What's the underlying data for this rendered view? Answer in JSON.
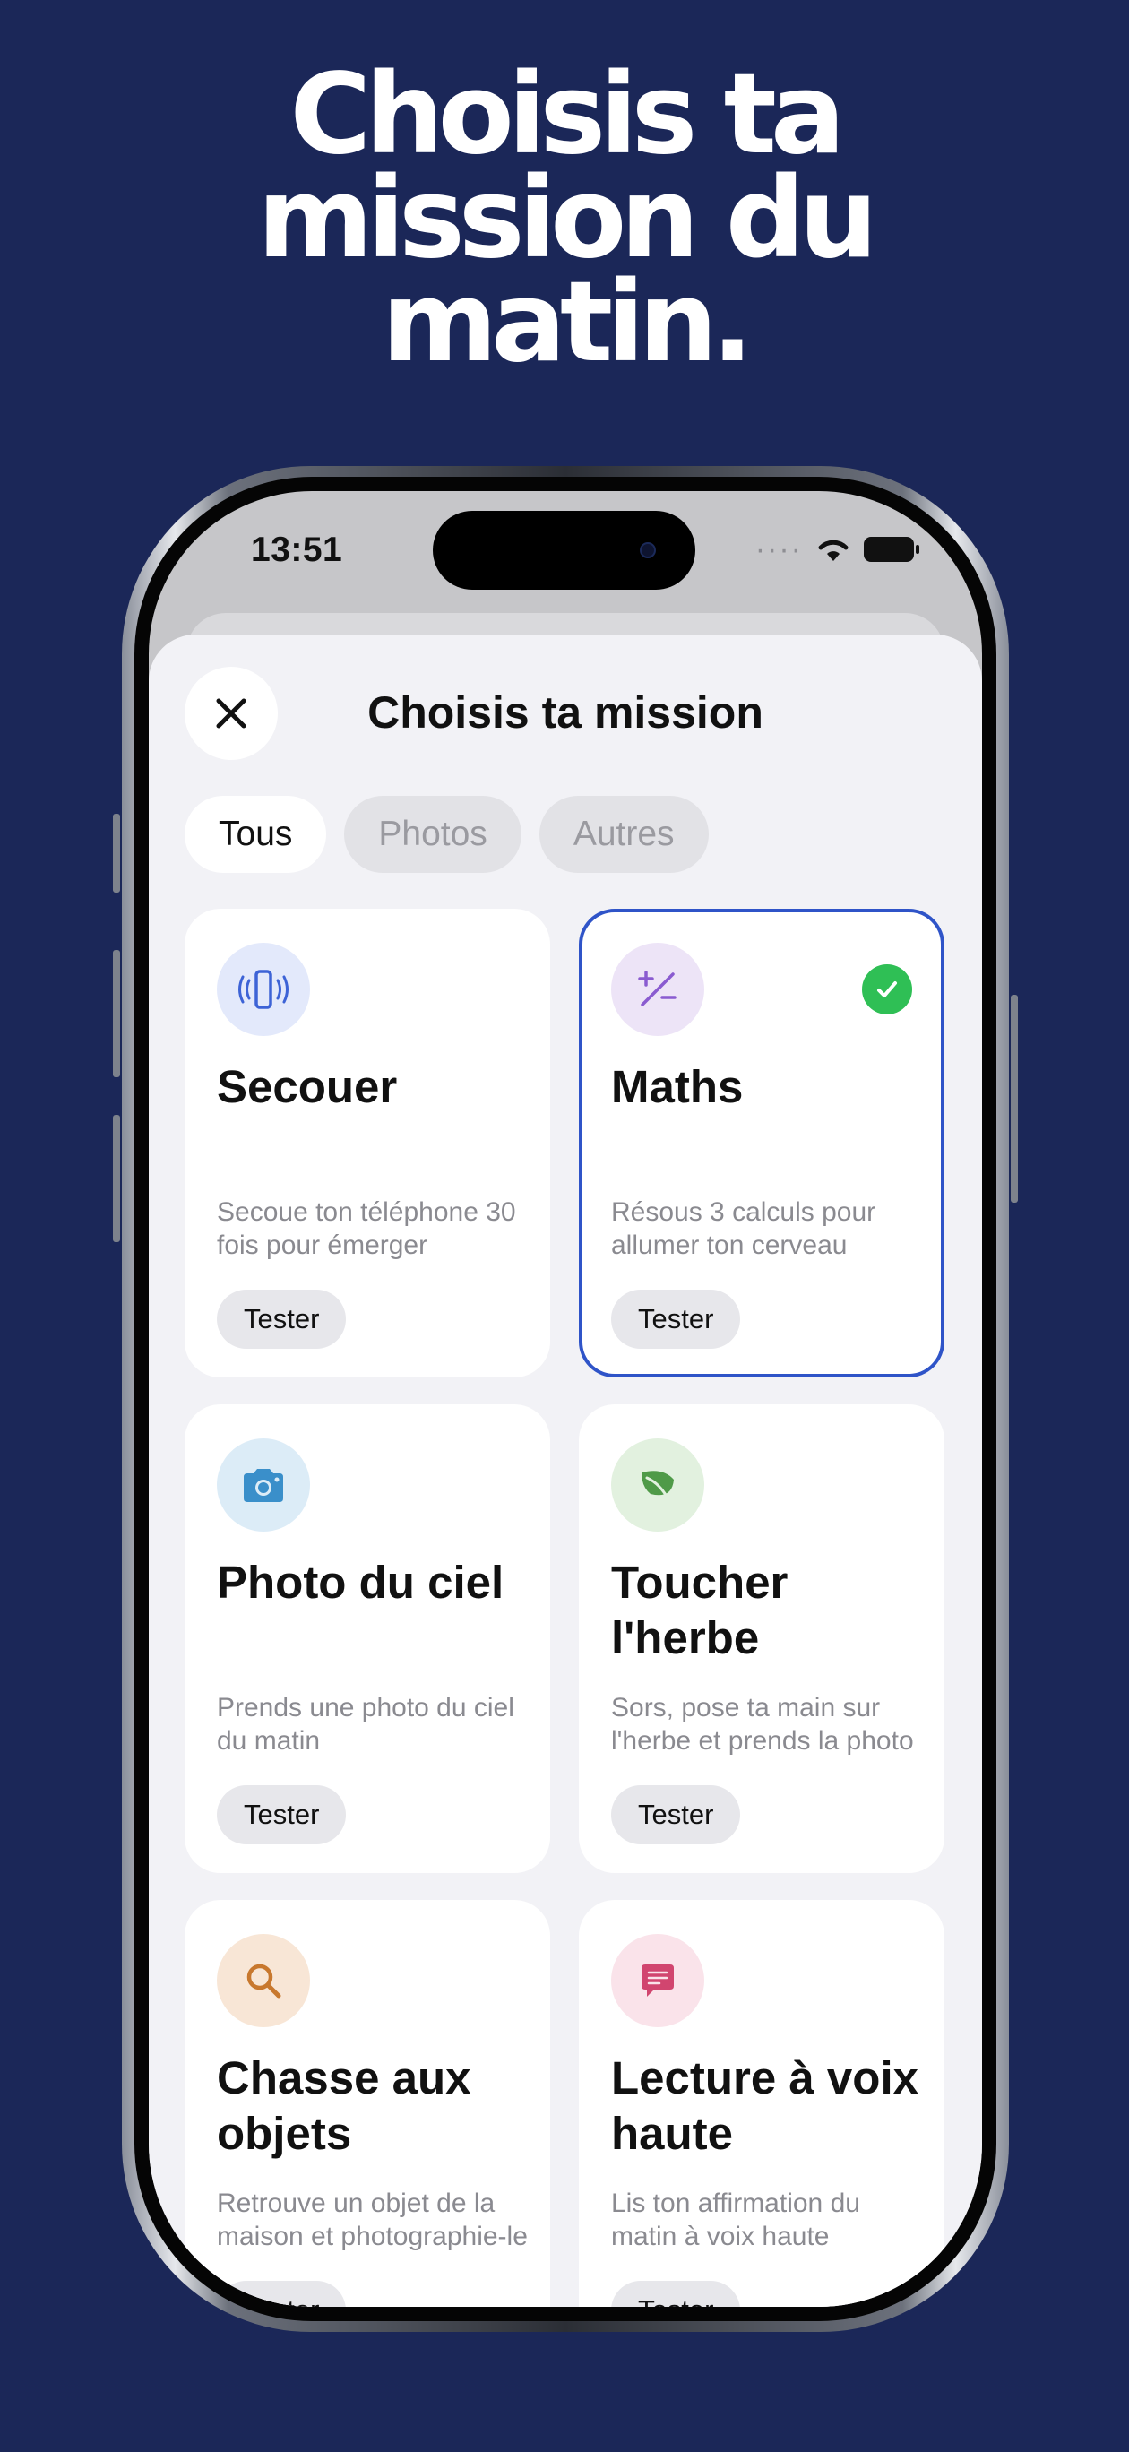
{
  "headline": {
    "line1": "Choisis ta",
    "line2": "mission du",
    "line3": "matin."
  },
  "status_bar": {
    "time": "13:51"
  },
  "sheet": {
    "title": "Choisis ta mission",
    "tabs": [
      {
        "label": "Tous",
        "active": true
      },
      {
        "label": "Photos",
        "active": false
      },
      {
        "label": "Autres",
        "active": false
      }
    ]
  },
  "missions": [
    {
      "title": "Secouer",
      "desc": "Secoue ton téléphone 30 fois pour émerger",
      "button": "Tester",
      "icon": "phone-shake-icon",
      "icon_bg": "#e3e9fb",
      "selected": false
    },
    {
      "title": "Maths",
      "desc": "Résous 3 calculs pour allumer ton cerveau",
      "button": "Tester",
      "icon": "plus-minus-icon",
      "icon_bg": "#ede4f7",
      "selected": true
    },
    {
      "title": "Photo du ciel",
      "desc": "Prends une photo du ciel du matin",
      "button": "Tester",
      "icon": "camera-icon",
      "icon_bg": "#dcecf7",
      "selected": false
    },
    {
      "title": "Toucher l'herbe",
      "desc": "Sors, pose ta main sur l'herbe et prends la photo",
      "button": "Tester",
      "icon": "leaf-icon",
      "icon_bg": "#e2f1df",
      "selected": false
    },
    {
      "title": "Chasse aux objets",
      "desc": "Retrouve un objet de la maison et photographie-le",
      "button": "Tester",
      "icon": "magnifier-icon",
      "icon_bg": "#f8e6d6",
      "selected": false
    },
    {
      "title": "Lecture à voix haute",
      "desc": "Lis ton affirmation du matin à voix haute",
      "button": "Tester",
      "icon": "speech-bubble-icon",
      "icon_bg": "#fae3ea",
      "selected": false
    }
  ],
  "colors": {
    "background": "#1b2758",
    "selected_border": "#2f54c8",
    "check": "#2fbf55"
  }
}
